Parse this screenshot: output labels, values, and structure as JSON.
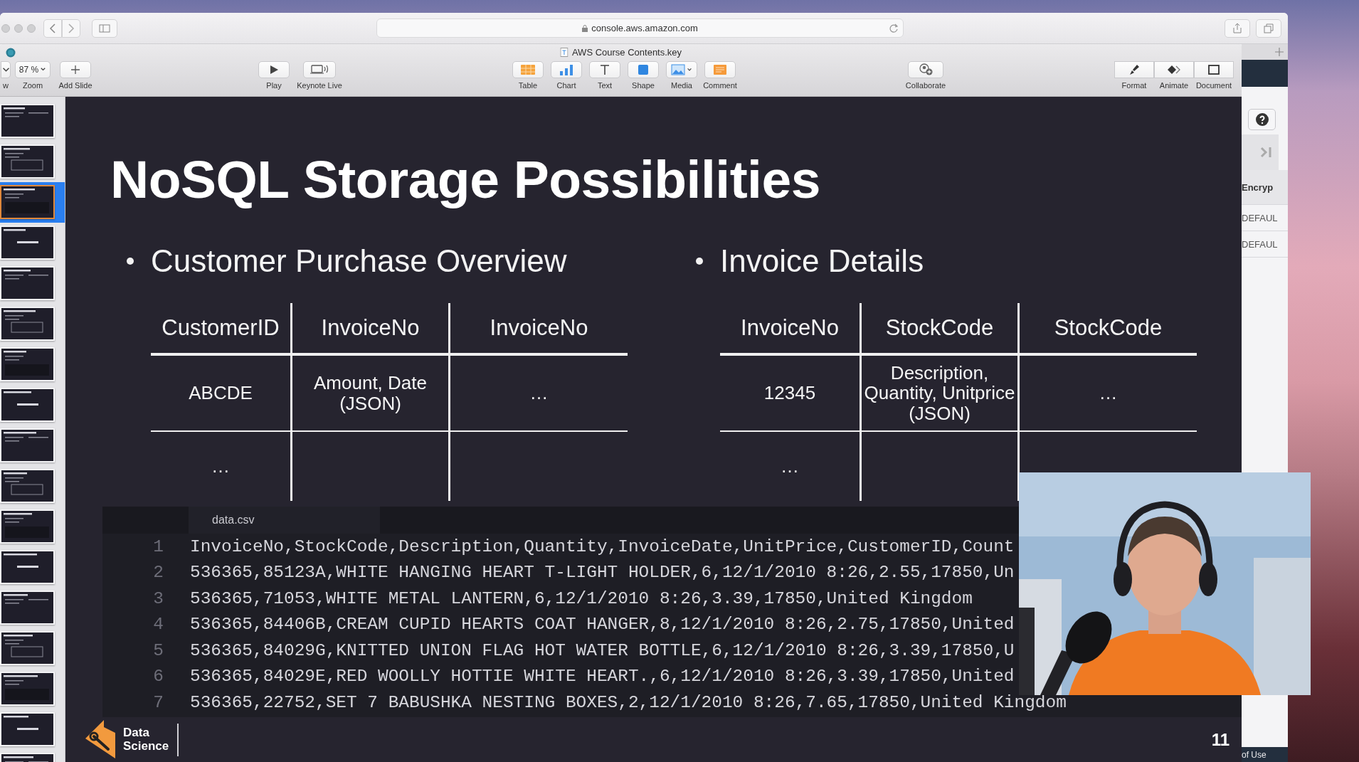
{
  "browser": {
    "url": "console.aws.amazon.com"
  },
  "keynote": {
    "title": "AWS Course Contents.key",
    "toolbar": [
      {
        "kind": "dropdown",
        "label": "w"
      },
      {
        "kind": "dropdown",
        "label": "Zoom",
        "value": "87 %"
      },
      {
        "kind": "button",
        "label": "Add Slide"
      },
      {
        "kind": "button",
        "label": "Play"
      },
      {
        "kind": "button",
        "label": "Keynote Live"
      },
      {
        "kind": "button",
        "label": "Table"
      },
      {
        "kind": "button",
        "label": "Chart"
      },
      {
        "kind": "button",
        "label": "Text"
      },
      {
        "kind": "button",
        "label": "Shape"
      },
      {
        "kind": "dropdown",
        "label": "Media"
      },
      {
        "kind": "button",
        "label": "Comment"
      },
      {
        "kind": "button",
        "label": "Collaborate"
      },
      {
        "kind": "button",
        "label": "Format"
      },
      {
        "kind": "button",
        "label": "Animate"
      },
      {
        "kind": "button",
        "label": "Document"
      }
    ]
  },
  "navigator": {
    "thumbnails": [
      {
        "selected": false
      },
      {
        "selected": false
      },
      {
        "selected": true
      },
      {
        "selected": false
      },
      {
        "selected": false
      },
      {
        "selected": false
      },
      {
        "selected": false
      },
      {
        "selected": false
      },
      {
        "selected": false
      },
      {
        "selected": false
      },
      {
        "selected": false
      },
      {
        "selected": false
      },
      {
        "selected": false
      },
      {
        "selected": false
      },
      {
        "selected": false
      },
      {
        "selected": false
      },
      {
        "selected": false
      }
    ]
  },
  "slide": {
    "title": "NoSQL Storage Possibilities",
    "columns": [
      {
        "bullet": "Customer Purchase Overview",
        "headers": [
          "CustomerID",
          "InvoiceNo",
          "InvoiceNo"
        ],
        "rows": [
          [
            "ABCDE",
            "Amount, Date (JSON)",
            "…"
          ],
          [
            "…"
          ]
        ]
      },
      {
        "bullet": "Invoice Details",
        "headers": [
          "InvoiceNo",
          "StockCode",
          "StockCode"
        ],
        "rows": [
          [
            "12345",
            "Description, Quantity, Unitprice (JSON)",
            "…"
          ],
          [
            "…"
          ]
        ]
      }
    ],
    "code_panel": {
      "tab": "data.csv",
      "lines": [
        {
          "number": "1",
          "text": "InvoiceNo,StockCode,Description,Quantity,InvoiceDate,UnitPrice,CustomerID,Count"
        },
        {
          "number": "2",
          "text": "536365,85123A,WHITE HANGING HEART T-LIGHT HOLDER,6,12/1/2010 8:26,2.55,17850,Un"
        },
        {
          "number": "3",
          "text": "536365,71053,WHITE METAL LANTERN,6,12/1/2010 8:26,3.39,17850,United Kingdom"
        },
        {
          "number": "4",
          "text": "536365,84406B,CREAM CUPID HEARTS COAT HANGER,8,12/1/2010 8:26,2.75,17850,United"
        },
        {
          "number": "5",
          "text": "536365,84029G,KNITTED UNION FLAG HOT WATER BOTTLE,6,12/1/2010 8:26,3.39,17850,U"
        },
        {
          "number": "6",
          "text": "536365,84029E,RED WOOLLY HOTTIE WHITE HEART.,6,12/1/2010 8:26,3.39,17850,United"
        },
        {
          "number": "7",
          "text": "536365,22752,SET 7 BABUSHKA NESTING BOXES,2,12/1/2010 8:26,7.65,17850,United Kingdom"
        }
      ]
    },
    "logo_text": "Data Science",
    "slide_number": "11"
  },
  "web_page": {
    "rows": [
      {
        "kind": "header",
        "text": "Encryp"
      },
      {
        "kind": "cell",
        "text": "DEFAUL"
      },
      {
        "kind": "cell",
        "text": "DEFAUL"
      }
    ],
    "footer": "of Use"
  }
}
